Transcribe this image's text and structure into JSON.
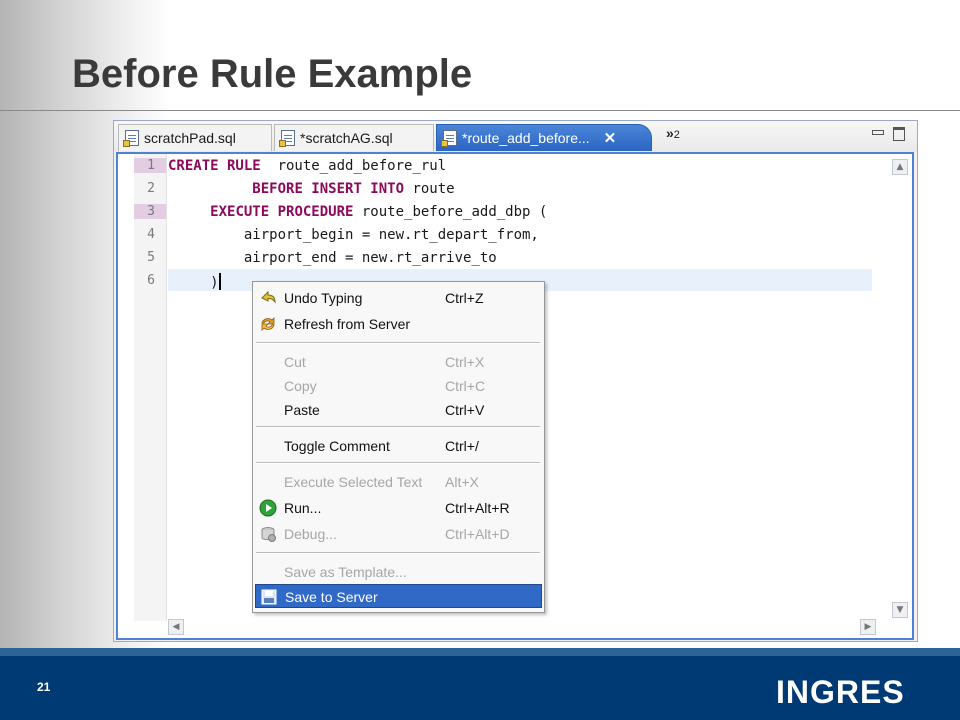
{
  "slide": {
    "title": "Before Rule Example",
    "page_number": "21",
    "logo_text": "INGRES"
  },
  "editor": {
    "tabs": [
      {
        "label": "scratchPad.sql",
        "active": false
      },
      {
        "label": "*scratchAG.sql",
        "active": false
      },
      {
        "label": "*route_add_before...",
        "active": true
      }
    ],
    "close_glyph": "✕",
    "overflow_glyph": "»",
    "overflow_count": "2",
    "line_numbers": [
      "1",
      "2",
      "3",
      "4",
      "5",
      "6"
    ],
    "code": {
      "l1_kw": "CREATE RULE",
      "l1_rest": "  route_add_before_rul",
      "l2_indent": "          ",
      "l2_kw": "BEFORE INSERT INTO",
      "l2_rest": " route",
      "l3_indent": "     ",
      "l3_kw": "EXECUTE PROCEDURE",
      "l3_rest": " route_before_add_dbp (",
      "l4": "         airport_begin = new.rt_depart_from,",
      "l5": "         airport_end = new.rt_arrive_to",
      "l6": "     )"
    }
  },
  "context_menu": {
    "items": [
      {
        "label": "Undo Typing",
        "shortcut": "Ctrl+Z",
        "icon": "undo-icon",
        "enabled": true
      },
      {
        "label": "Refresh from Server",
        "shortcut": "",
        "icon": "refresh-icon",
        "enabled": true
      },
      {
        "label": "Cut",
        "shortcut": "Ctrl+X",
        "enabled": false
      },
      {
        "label": "Copy",
        "shortcut": "Ctrl+C",
        "enabled": false
      },
      {
        "label": "Paste",
        "shortcut": "Ctrl+V",
        "enabled": true
      },
      {
        "label": "Toggle Comment",
        "shortcut": "Ctrl+/",
        "enabled": true
      },
      {
        "label": "Execute Selected Text",
        "shortcut": "Alt+X",
        "enabled": false
      },
      {
        "label": "Run...",
        "shortcut": "Ctrl+Alt+R",
        "icon": "run-icon",
        "enabled": true
      },
      {
        "label": "Debug...",
        "shortcut": "Ctrl+Alt+D",
        "icon": "debug-icon",
        "enabled": false
      },
      {
        "label": "Save as Template...",
        "shortcut": "",
        "enabled": false
      },
      {
        "label": "Save to Server",
        "shortcut": "",
        "icon": "save-server-icon",
        "enabled": true,
        "selected": true
      }
    ]
  },
  "colors": {
    "keyword": "#8b0a5c",
    "selection": "#3169c6",
    "footer": "#003a74",
    "active_tab": "#2b64c2"
  }
}
